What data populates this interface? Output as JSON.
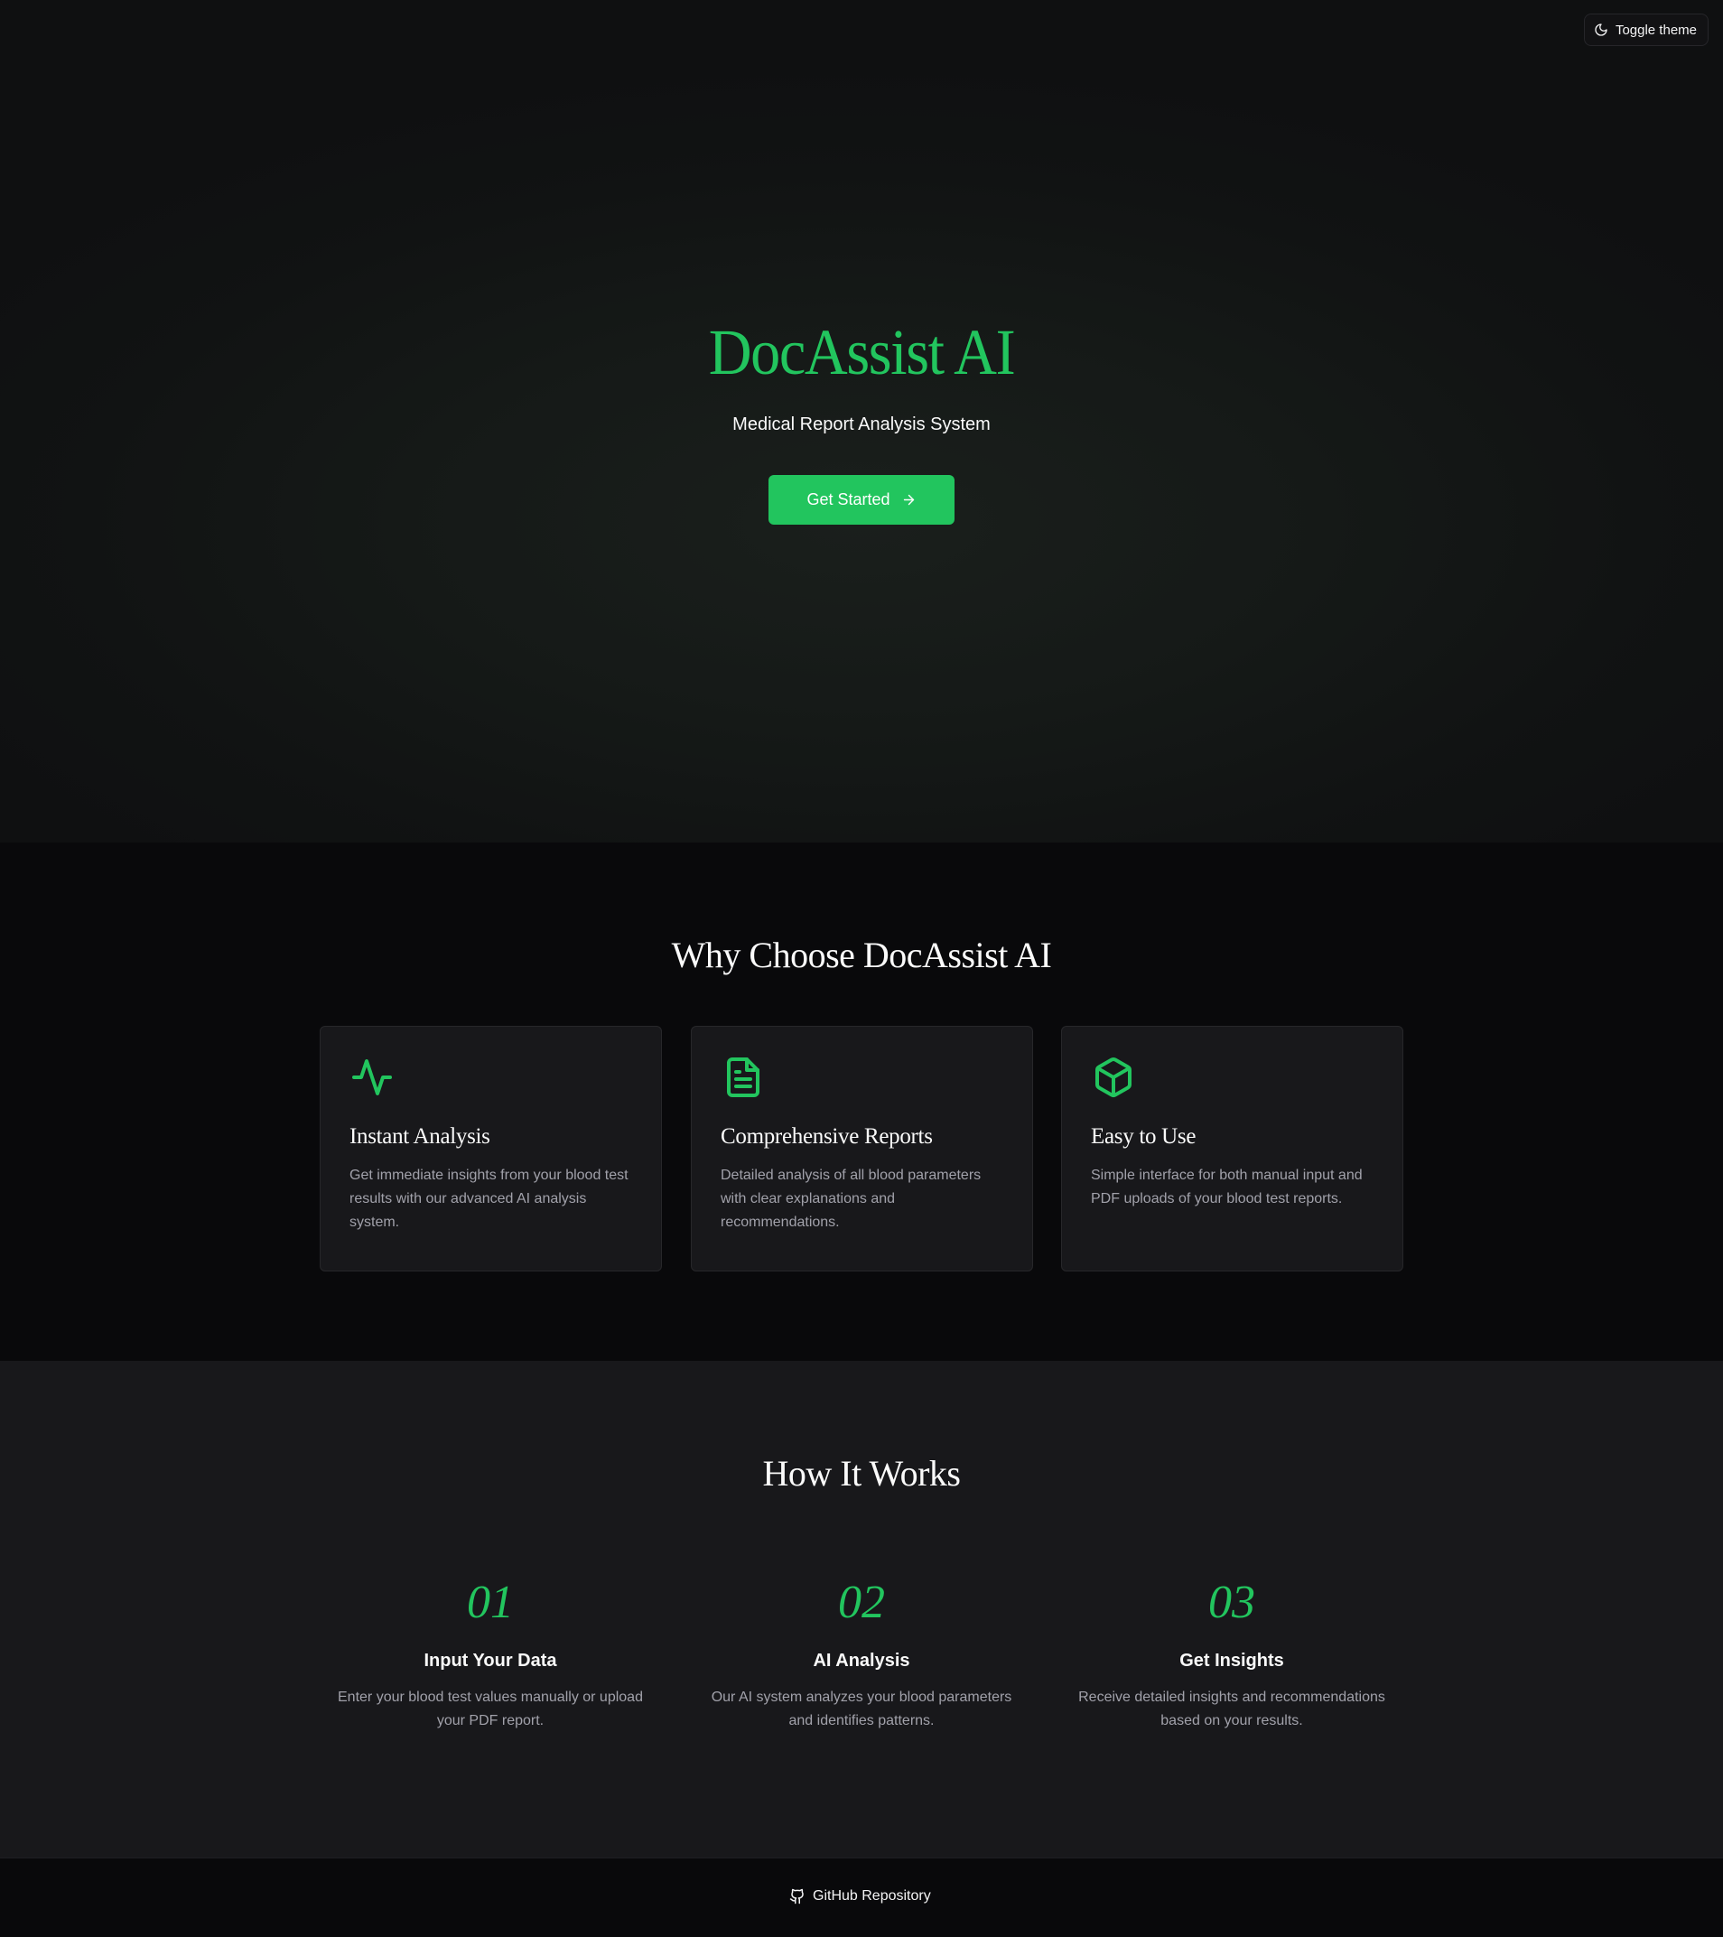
{
  "header": {
    "theme_toggle_label": "Toggle theme",
    "theme_toggle_icon": "moon-icon"
  },
  "hero": {
    "title": "DocAssist AI",
    "subtitle": "Medical Report Analysis System",
    "cta_label": "Get Started",
    "cta_icon": "arrow-right-icon"
  },
  "features": {
    "title": "Why Choose DocAssist AI",
    "items": [
      {
        "icon": "activity-icon",
        "title": "Instant Analysis",
        "description": "Get immediate insights from your blood test results with our advanced AI analysis system."
      },
      {
        "icon": "file-text-icon",
        "title": "Comprehensive Reports",
        "description": "Detailed analysis of all blood parameters with clear explanations and recommendations."
      },
      {
        "icon": "box-icon",
        "title": "Easy to Use",
        "description": "Simple interface for both manual input and PDF uploads of your blood test reports."
      }
    ]
  },
  "how": {
    "title": "How It Works",
    "steps": [
      {
        "number": "01",
        "title": "Input Your Data",
        "description": "Enter your blood test values manually or upload your PDF report."
      },
      {
        "number": "02",
        "title": "AI Analysis",
        "description": "Our AI system analyzes your blood parameters and identifies patterns."
      },
      {
        "number": "03",
        "title": "Get Insights",
        "description": "Receive detailed insights and recommendations based on your results."
      }
    ]
  },
  "footer": {
    "link_label": "GitHub Repository",
    "link_icon": "github-icon"
  },
  "colors": {
    "accent": "#22c55e",
    "background": "#09090b",
    "surface": "#18181b",
    "muted_text": "#a1a1aa"
  }
}
